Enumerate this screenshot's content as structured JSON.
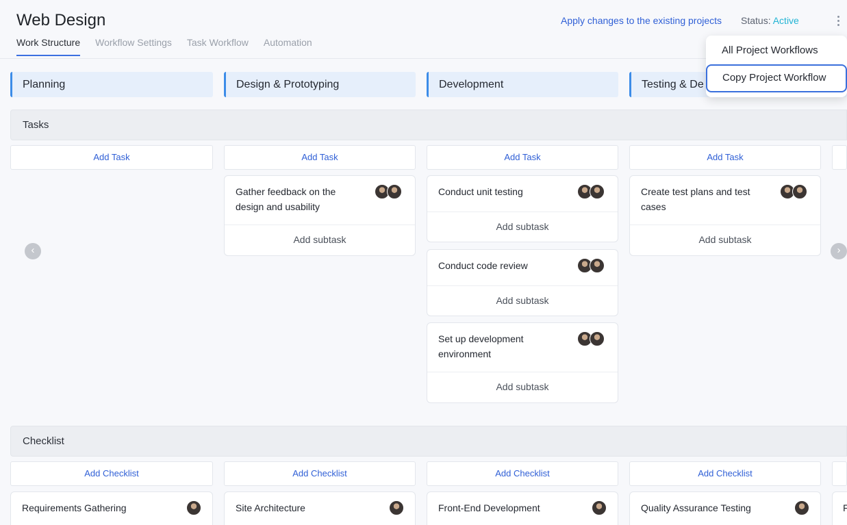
{
  "header": {
    "title": "Web Design",
    "tabs": [
      "Work Structure",
      "Workflow Settings",
      "Task Workflow",
      "Automation"
    ],
    "apply_link": "Apply changes to the existing projects",
    "status_label": "Status:",
    "status_value": "Active"
  },
  "columns": [
    "Planning",
    "Design & Prototyping",
    "Development",
    "Testing & De"
  ],
  "sections": {
    "tasks": "Tasks",
    "checklist": "Checklist"
  },
  "add_task": "Add Task",
  "add_subtask": "Add subtask",
  "add_checklist": "Add Checklist",
  "tasks": {
    "design": [
      "Gather feedback on the design and usability"
    ],
    "development": [
      "Conduct unit testing",
      "Conduct code review",
      "Set up development environment"
    ],
    "testing": [
      "Create test plans and test cases"
    ]
  },
  "checklists": [
    "Requirements Gathering",
    "Site Architecture",
    "Front-End Development",
    "Quality Assurance Testing",
    "F"
  ],
  "menu": {
    "items": [
      "All Project Workflows",
      "Copy Project Workflow"
    ]
  },
  "icons": {
    "avatar": "user-avatar-icon",
    "prev": "chevron-left-icon",
    "next": "chevron-right-icon",
    "more": "more-vertical-icon"
  },
  "colors": {
    "accent": "#2f5fd6",
    "column_bar": "#3c8ce8",
    "status_active": "#22b4d4",
    "menu_selected_border": "#3a6fdc"
  }
}
